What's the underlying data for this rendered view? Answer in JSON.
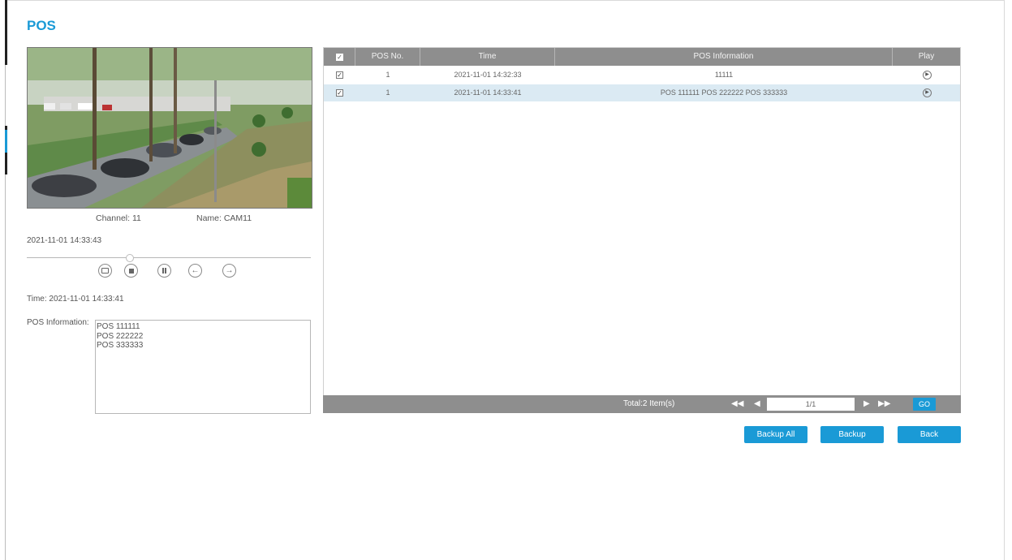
{
  "page": {
    "title": "POS"
  },
  "preview": {
    "channel_text": "Channel: 11",
    "name_text": "Name: CAM11",
    "timestamp": "2021-11-01 14:33:43",
    "progress": 0.36,
    "time_text": "Time: 2021-11-01 14:33:41",
    "pos_label": "POS Information:",
    "pos_lines": [
      "POS 111111",
      "POS 222222",
      "POS 333333"
    ],
    "controls": [
      "snapshot-icon",
      "stop-icon",
      "pause-icon",
      "rewind-icon",
      "forward-icon"
    ]
  },
  "table": {
    "columns": [
      "POS No.",
      "Time",
      "POS Information",
      "Play"
    ],
    "rows": [
      {
        "checked": true,
        "pos_no": "1",
        "time": "2021-11-01 14:32:33",
        "info": "11111",
        "selected": false
      },
      {
        "checked": true,
        "pos_no": "1",
        "time": "2021-11-01 14:33:41",
        "info": "POS 111111 POS 222222 POS 333333",
        "selected": true
      }
    ],
    "footer": {
      "total": "Total:2 Item(s)",
      "page": "1/1",
      "go_label": "GO"
    }
  },
  "actions": {
    "backup_all": "Backup All",
    "backup": "Backup",
    "back": "Back"
  },
  "colors": {
    "accent": "#1a9ad6",
    "header_bg": "#8e8e8e",
    "selected_row": "#dbeaf3"
  }
}
